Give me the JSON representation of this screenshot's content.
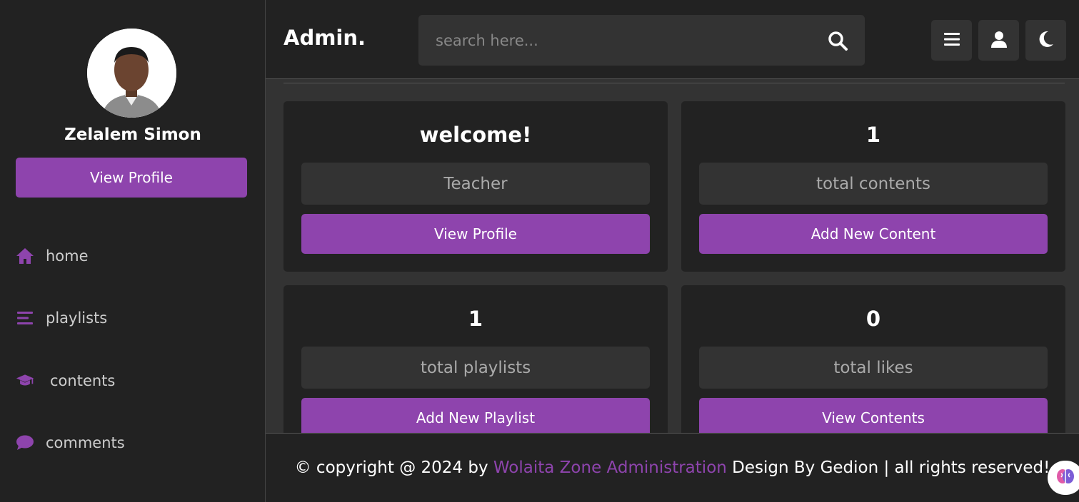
{
  "sidebar": {
    "profile_name": "Zelalem Simon",
    "view_profile_label": "View Profile",
    "nav": [
      {
        "label": "home",
        "icon": "home-icon"
      },
      {
        "label": "playlists",
        "icon": "list-icon"
      },
      {
        "label": "contents",
        "icon": "graduation-cap-icon"
      },
      {
        "label": "comments",
        "icon": "comment-icon"
      }
    ]
  },
  "header": {
    "logo": "Admin.",
    "search_placeholder": "search here...",
    "buttons": [
      "menu-icon",
      "user-icon",
      "moon-icon"
    ]
  },
  "cards": [
    {
      "title": "welcome!",
      "info": "Teacher",
      "button": "View Profile"
    },
    {
      "title": "1",
      "info": "total contents",
      "button": "Add New Content"
    },
    {
      "title": "1",
      "info": "total playlists",
      "button": "Add New Playlist"
    },
    {
      "title": "0",
      "info": "total likes",
      "button": "View Contents"
    }
  ],
  "footer": {
    "prefix": "© copyright @ 2024 by ",
    "link": "Wolaita Zone Administration",
    "suffix": " Design By Gedion | all rights reserved!"
  },
  "colors": {
    "accent": "#8e44ad",
    "panel": "#222222",
    "background": "#333333"
  }
}
